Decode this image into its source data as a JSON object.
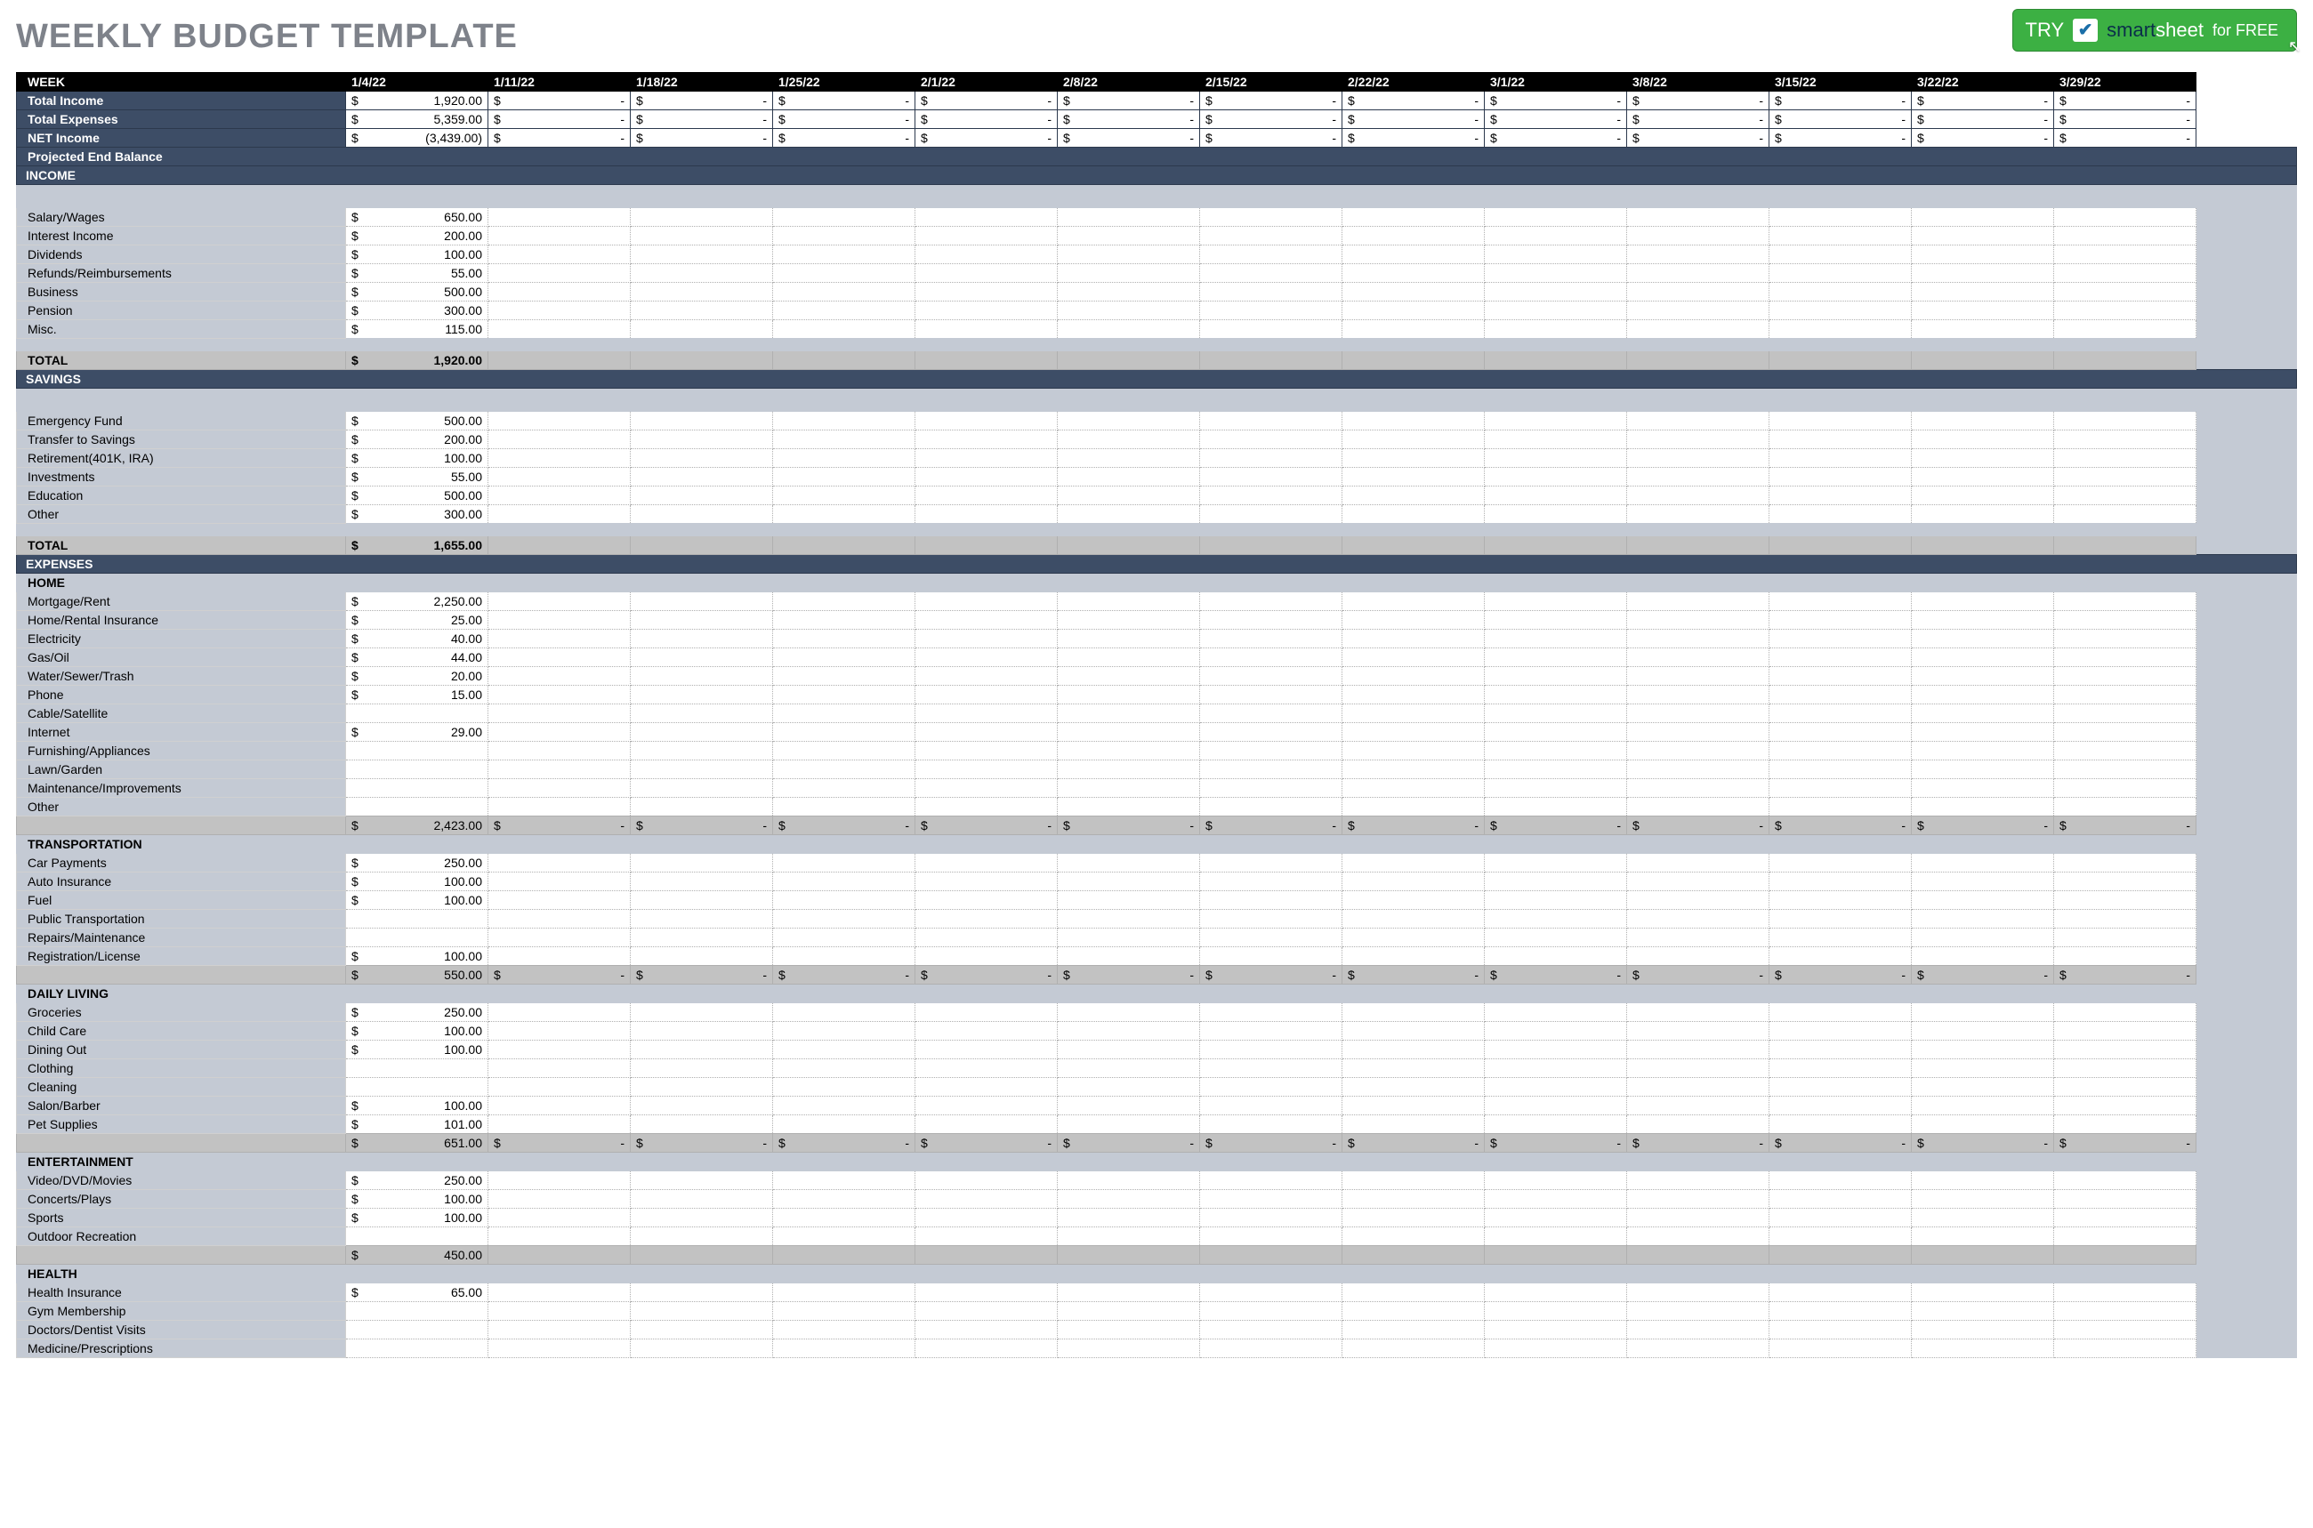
{
  "title": "WEEKLY BUDGET TEMPLATE",
  "try_button": {
    "try_label": "TRY",
    "brand_dark": "smart",
    "brand_light": "sheet",
    "for_free": "for FREE"
  },
  "weeks": [
    "1/4/22",
    "1/11/22",
    "1/18/22",
    "1/25/22",
    "2/1/22",
    "2/8/22",
    "2/15/22",
    "2/22/22",
    "3/1/22",
    "3/8/22",
    "3/15/22",
    "3/22/22",
    "3/29/22"
  ],
  "summary": {
    "week_label": "WEEK",
    "total_income_label": "Total Income",
    "total_income_first": "1,920.00",
    "total_expenses_label": "Total Expenses",
    "total_expenses_first": "5,359.00",
    "net_income_label": "NET Income",
    "net_income_first": "(3,439.00)",
    "projected_label": "Projected End Balance"
  },
  "income": {
    "header": "INCOME",
    "rows": [
      {
        "label": "Salary/Wages",
        "val": "650.00"
      },
      {
        "label": "Interest Income",
        "val": "200.00"
      },
      {
        "label": "Dividends",
        "val": "100.00"
      },
      {
        "label": "Refunds/Reimbursements",
        "val": "55.00"
      },
      {
        "label": "Business",
        "val": "500.00"
      },
      {
        "label": "Pension",
        "val": "300.00"
      },
      {
        "label": "Misc.",
        "val": "115.00"
      }
    ],
    "total_label": "TOTAL",
    "total_val": "1,920.00"
  },
  "savings": {
    "header": "SAVINGS",
    "rows": [
      {
        "label": "Emergency Fund",
        "val": "500.00"
      },
      {
        "label": "Transfer to Savings",
        "val": "200.00"
      },
      {
        "label": "Retirement(401K, IRA)",
        "val": "100.00"
      },
      {
        "label": "Investments",
        "val": "55.00"
      },
      {
        "label": "Education",
        "val": "500.00"
      },
      {
        "label": "Other",
        "val": "300.00"
      }
    ],
    "total_label": "TOTAL",
    "total_val": "1,655.00"
  },
  "expenses": {
    "header": "EXPENSES",
    "categories": [
      {
        "name": "HOME",
        "rows": [
          {
            "label": "Mortgage/Rent",
            "val": "2,250.00"
          },
          {
            "label": "Home/Rental Insurance",
            "val": "25.00"
          },
          {
            "label": "Electricity",
            "val": "40.00"
          },
          {
            "label": "Gas/Oil",
            "val": "44.00"
          },
          {
            "label": "Water/Sewer/Trash",
            "val": "20.00"
          },
          {
            "label": "Phone",
            "val": "15.00"
          },
          {
            "label": "Cable/Satellite",
            "val": ""
          },
          {
            "label": "Internet",
            "val": "29.00"
          },
          {
            "label": "Furnishing/Appliances",
            "val": ""
          },
          {
            "label": "Lawn/Garden",
            "val": ""
          },
          {
            "label": "Maintenance/Improvements",
            "val": ""
          },
          {
            "label": "Other",
            "val": ""
          }
        ],
        "subtotal": "2,423.00",
        "show_other_subtotals": true
      },
      {
        "name": "TRANSPORTATION",
        "rows": [
          {
            "label": "Car Payments",
            "val": "250.00"
          },
          {
            "label": "Auto Insurance",
            "val": "100.00"
          },
          {
            "label": "Fuel",
            "val": "100.00"
          },
          {
            "label": "Public Transportation",
            "val": ""
          },
          {
            "label": "Repairs/Maintenance",
            "val": ""
          },
          {
            "label": "Registration/License",
            "val": "100.00"
          }
        ],
        "subtotal": "550.00",
        "show_other_subtotals": true
      },
      {
        "name": "DAILY LIVING",
        "rows": [
          {
            "label": "Groceries",
            "val": "250.00"
          },
          {
            "label": "Child Care",
            "val": "100.00"
          },
          {
            "label": "Dining Out",
            "val": "100.00"
          },
          {
            "label": "Clothing",
            "val": ""
          },
          {
            "label": "Cleaning",
            "val": ""
          },
          {
            "label": "Salon/Barber",
            "val": "100.00"
          },
          {
            "label": "Pet Supplies",
            "val": "101.00"
          }
        ],
        "subtotal": "651.00",
        "show_other_subtotals": true
      },
      {
        "name": "ENTERTAINMENT",
        "rows": [
          {
            "label": "Video/DVD/Movies",
            "val": "250.00"
          },
          {
            "label": "Concerts/Plays",
            "val": "100.00"
          },
          {
            "label": "Sports",
            "val": "100.00"
          },
          {
            "label": "Outdoor Recreation",
            "val": ""
          }
        ],
        "subtotal": "450.00",
        "show_other_subtotals": false
      },
      {
        "name": "HEALTH",
        "rows": [
          {
            "label": "Health Insurance",
            "val": "65.00"
          },
          {
            "label": "Gym Membership",
            "val": ""
          },
          {
            "label": "Doctors/Dentist Visits",
            "val": ""
          },
          {
            "label": "Medicine/Prescriptions",
            "val": ""
          }
        ],
        "subtotal": null,
        "show_other_subtotals": false
      }
    ]
  },
  "dash": "-",
  "currency": "$"
}
